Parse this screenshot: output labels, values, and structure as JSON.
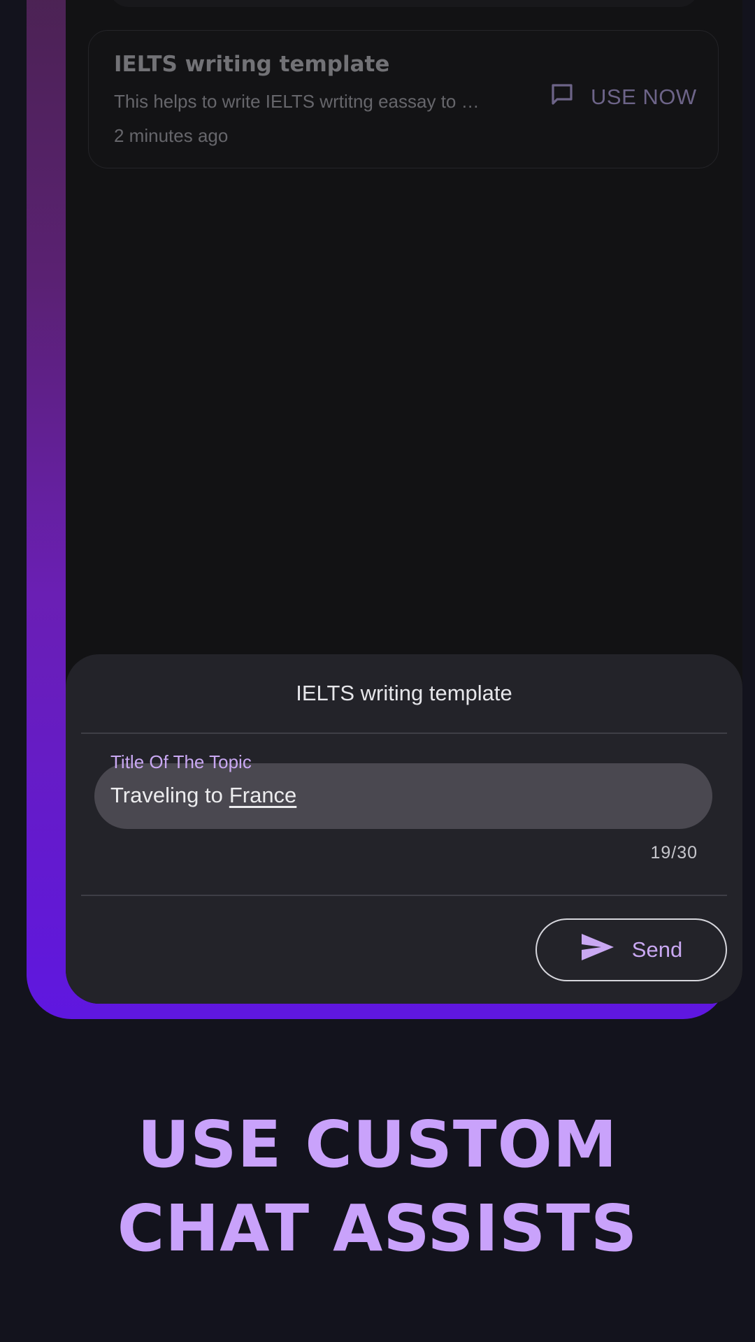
{
  "template_card": {
    "title": "IELTS writing template",
    "description": "This helps to write IELTS wrtitng eassay to …",
    "time": "2 minutes ago",
    "use_now_label": "USE NOW",
    "use_now_icon": "chat-bubble-icon"
  },
  "sheet": {
    "title": "IELTS writing template",
    "field": {
      "label": "Title Of The Topic",
      "value_prefix": "Traveling to",
      "value_underlined": "France",
      "counter": "19/30"
    },
    "send_label": "Send",
    "send_icon": "send-icon"
  },
  "headline": {
    "line1": "USE CUSTOM",
    "line2": "CHAT ASSISTS"
  },
  "colors": {
    "background": "#13131d",
    "accent": "#c9a2fb",
    "frame_top": "#4a2350",
    "frame_bottom": "#5f17e0"
  }
}
